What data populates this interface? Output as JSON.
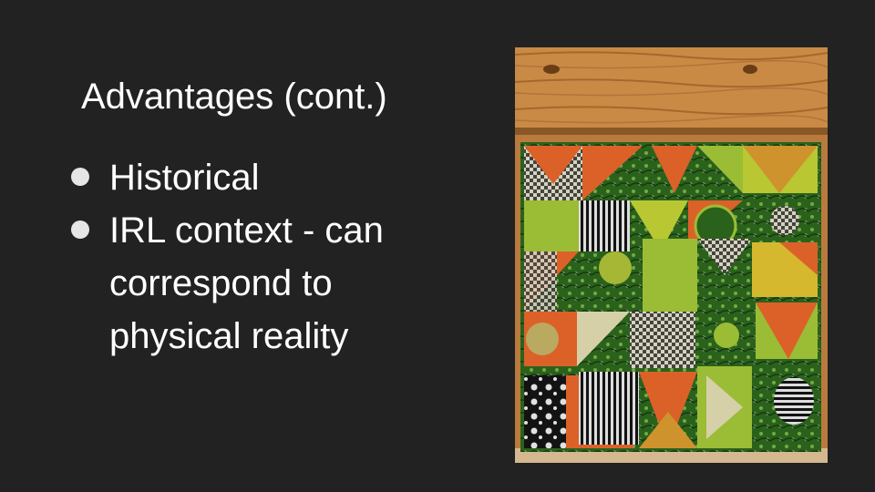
{
  "slide": {
    "title": "Advantages (cont.)",
    "bullets": [
      "Historical",
      "IRL context - can correspond to physical reality"
    ]
  },
  "photo": {
    "icon": "quilt-photo",
    "colors": {
      "wood": "#c98a45",
      "green": "#2e6b1f",
      "lime": "#a9cc3a",
      "orange": "#ef6a2c",
      "cream": "#e9e2b8",
      "black": "#151515"
    }
  }
}
